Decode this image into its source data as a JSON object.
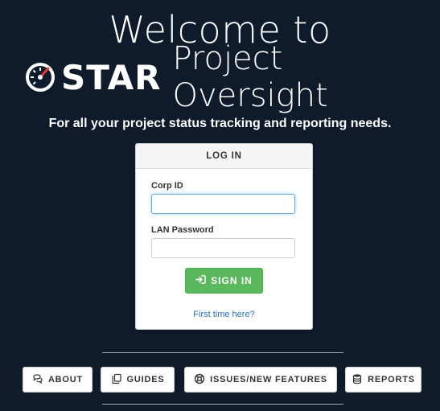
{
  "header": {
    "welcome_text": "Welcome to",
    "brand_word": "STAR",
    "brand_suffix": "Project Oversight",
    "tagline": "For all your project status tracking and reporting needs."
  },
  "login": {
    "title": "LOG IN",
    "corp_id_label": "Corp ID",
    "corp_id_value": "",
    "password_label": "LAN Password",
    "password_value": "",
    "signin_label": "SIGN IN",
    "first_time_link": "First time here?"
  },
  "nav": {
    "about": "ABOUT",
    "guides": "GUIDES",
    "issues": "ISSUES/NEW FEATURES",
    "reports": "REPORTS"
  },
  "icons": {
    "logo": "speedometer-logo-icon",
    "signin": "sign-in-icon",
    "about": "comments-icon",
    "guides": "copy-icon",
    "issues": "life-ring-icon",
    "reports": "database-icon"
  },
  "colors": {
    "background": "#0f1a2b",
    "signin_button": "#5cb85c",
    "link": "#2a6fbd",
    "focus_ring": "#66afe9"
  }
}
